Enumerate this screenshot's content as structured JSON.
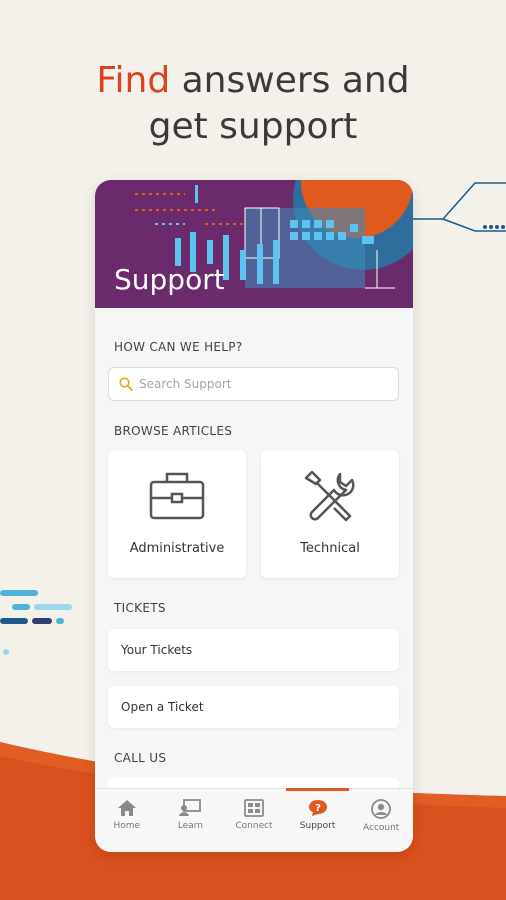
{
  "headline": {
    "accent": "Find",
    "rest_line1": " answers and",
    "line2": "get support"
  },
  "colors": {
    "accent_orange": "#d9431e",
    "hero_purple": "#6b2a6b",
    "nav_active": "#e05a1e",
    "background": "#f4f1ea"
  },
  "hero": {
    "title": "Support"
  },
  "help": {
    "label": "HOW CAN WE HELP?",
    "search_placeholder": "Search Support",
    "search_icon": "search-icon"
  },
  "browse": {
    "label": "BROWSE ARTICLES",
    "cards": [
      {
        "label": "Administrative",
        "icon": "briefcase-icon"
      },
      {
        "label": "Technical",
        "icon": "tools-icon"
      }
    ]
  },
  "tickets": {
    "label": "TICKETS",
    "items": [
      {
        "label": "Your Tickets"
      },
      {
        "label": "Open a Ticket"
      }
    ]
  },
  "call_us": {
    "label": "CALL US"
  },
  "nav": {
    "items": [
      {
        "label": "Home",
        "icon": "home-icon"
      },
      {
        "label": "Learn",
        "icon": "learn-icon"
      },
      {
        "label": "Connect",
        "icon": "connect-icon"
      },
      {
        "label": "Support",
        "icon": "support-icon",
        "active": true
      },
      {
        "label": "Account",
        "icon": "account-icon"
      }
    ]
  }
}
